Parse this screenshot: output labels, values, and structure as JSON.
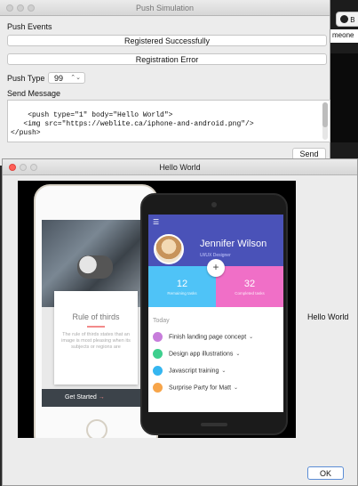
{
  "background_app": {
    "github_tab_label": "B",
    "name_fragment": "meone"
  },
  "push_simulation": {
    "title": "Push Simulation",
    "push_events_label": "Push Events",
    "registered_button": "Registered Successfully",
    "registration_error_button": "Registration Error",
    "push_type_label": "Push Type",
    "push_type_value": "99",
    "send_message_label": "Send Message",
    "message_text": "<push type=\"1\" body=\"Hello World\">\n   <img src=\"https://weblite.ca/iphone-and-android.png\"/>\n</push>",
    "send_button": "Send"
  },
  "hello_world": {
    "title": "Hello World",
    "label": "Hello World",
    "ok_button": "OK",
    "image": {
      "white_phone": {
        "card_title": "Rule of thirds",
        "card_body": "The rule of thirds states that an image is most pleasing when its subjects or regions are",
        "cta": "Get Started"
      },
      "black_phone": {
        "user_name": "Jennifer Wilson",
        "user_role": "UI/UX Designer",
        "stats": [
          {
            "value": "12",
            "label": "Remaining tasks",
            "color": "#4fc3f7"
          },
          {
            "value": "32",
            "label": "Completed tasks",
            "color": "#f06fc7"
          }
        ],
        "plus_symbol": "+",
        "section_label": "Today",
        "tasks": [
          {
            "label": "Finish landing page concept",
            "color": "#c77ddb"
          },
          {
            "label": "Design app illustrations",
            "color": "#3ecf8e"
          },
          {
            "label": "Javascript training",
            "color": "#35b6f0"
          },
          {
            "label": "Surprise Party for Matt",
            "color": "#f7a54a"
          }
        ]
      }
    }
  }
}
